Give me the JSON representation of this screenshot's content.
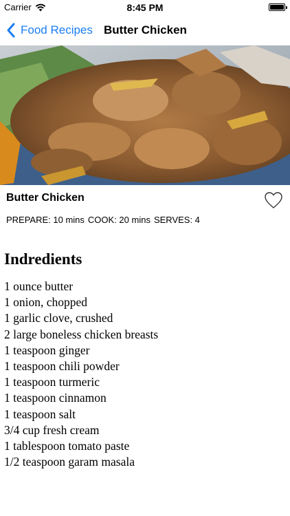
{
  "status_bar": {
    "carrier": "Carrier",
    "time": "8:45 PM"
  },
  "nav": {
    "back_label": "Food Recipes",
    "title": "Butter Chicken",
    "accent_color": "#1a7df2"
  },
  "recipe": {
    "title": "Butter Chicken",
    "prepare": "PREPARE: 10 mins",
    "cook": "COOK: 20 mins",
    "serves": "SERVES:  4",
    "favorite_icon": "heart-outline-icon"
  },
  "ingredients": {
    "heading": "Indredients",
    "items": [
      "1 ounce butter",
      "1 onion, chopped",
      "1 garlic clove, crushed",
      "2 large boneless chicken breasts",
      "1 teaspoon ginger",
      "1 teaspoon chili powder",
      "1 teaspoon turmeric",
      "1 teaspoon cinnamon",
      "1 teaspoon salt",
      "3/4 cup fresh cream",
      "1 tablespoon tomato paste",
      "1/2 teaspoon garam masala"
    ]
  }
}
